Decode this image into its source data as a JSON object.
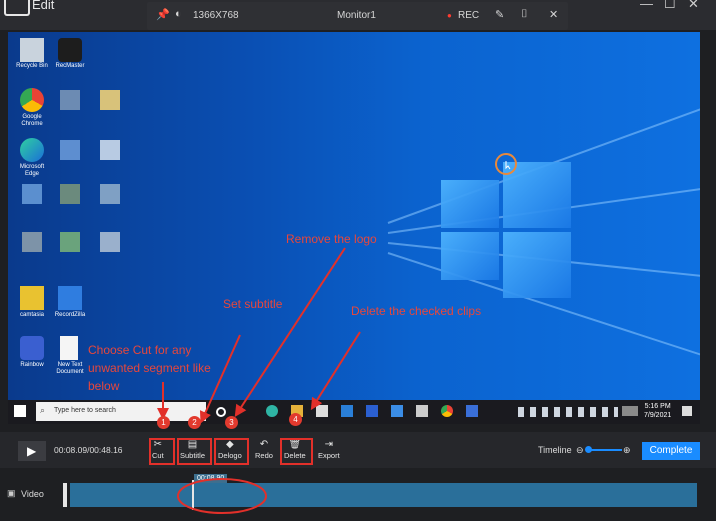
{
  "app": {
    "title": "Edit"
  },
  "recorder": {
    "resolution": "1366X768",
    "monitor": "Monitor1",
    "rec_label": "REC"
  },
  "desktop_icons": [
    {
      "label": "Recycle Bin"
    },
    {
      "label": "RecMaster"
    },
    {
      "label": "Google Chrome"
    },
    {
      "label": "Microsoft Edge"
    },
    {
      "label": "camtasia"
    },
    {
      "label": "RecordZilla"
    },
    {
      "label": "Rainbow"
    },
    {
      "label": "New Text Document"
    }
  ],
  "taskbar": {
    "search_placeholder": "Type here to search",
    "time": "5:16 PM",
    "date": "7/9/2021"
  },
  "annotations": {
    "cut": "Choose Cut for any unwanted segment like below",
    "subtitle": "Set subtitle",
    "delogo": "Remove the logo",
    "delete": "Delete the checked clips",
    "badges": [
      "1",
      "2",
      "3",
      "4"
    ]
  },
  "toolbar": {
    "time": "00:08.09/00:48.16",
    "tools": [
      {
        "id": "cut",
        "label": "Cut",
        "icon": "scissors-icon"
      },
      {
        "id": "subtitle",
        "label": "Subtitle",
        "icon": "subtitle-icon"
      },
      {
        "id": "delogo",
        "label": "Delogo",
        "icon": "eraser-icon"
      },
      {
        "id": "redo",
        "label": "Redo",
        "icon": "redo-icon"
      },
      {
        "id": "delete",
        "label": "Delete",
        "icon": "trash-icon"
      },
      {
        "id": "export",
        "label": "Export",
        "icon": "export-icon"
      }
    ],
    "timeline_label": "Timeline",
    "complete_label": "Complete"
  },
  "track": {
    "label": "Video",
    "selection_time": "00:08.90"
  },
  "colors": {
    "accent": "#1a8cff",
    "annotation": "#e8473b",
    "desktop_blue": "#0b5ed0"
  }
}
